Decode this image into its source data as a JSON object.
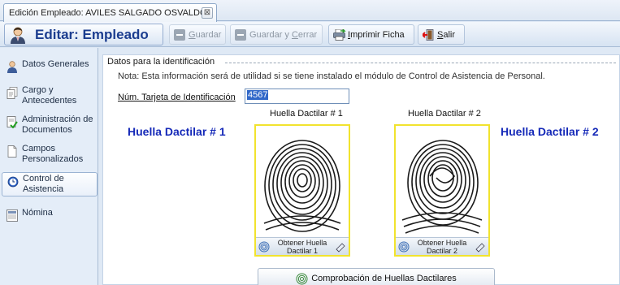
{
  "tab": {
    "label": "Edición Empleado: AVILES SALGADO OSVALDO",
    "close_glyph": "⊠"
  },
  "toolbar": {
    "title": "Editar: Empleado",
    "buttons": [
      {
        "label_ul": "G",
        "label_rest": "uardar",
        "icon": "save-icon",
        "enabled": false
      },
      {
        "label_ul": "",
        "label_rest": "Guardar y ",
        "label_ul2": "C",
        "label_rest2": "errar",
        "icon": "save-close-icon",
        "enabled": false
      },
      {
        "label_ul": "I",
        "label_rest": "mprimir Ficha",
        "icon": "print-icon",
        "enabled": true
      },
      {
        "label_ul": "S",
        "label_rest": "alir",
        "icon": "exit-icon",
        "enabled": true
      }
    ]
  },
  "sidebar": {
    "items": [
      {
        "label": "Datos Generales",
        "icon": "person-icon",
        "active": false
      },
      {
        "label": "Cargo y Antecedentes",
        "icon": "documents-icon",
        "active": false
      },
      {
        "label": "Administración de Documentos",
        "icon": "document-check-icon",
        "active": false
      },
      {
        "label": "Campos Personalizados",
        "icon": "page-icon",
        "active": false
      },
      {
        "label": "Control de Asistencia",
        "icon": "clock-icon",
        "active": true
      },
      {
        "label": "Nómina",
        "icon": "payroll-icon",
        "active": false
      }
    ]
  },
  "section": {
    "title": "Datos para la identificación",
    "note": "Nota: Esta información será de utilidad si se tiene instalado el módulo de Control de Asistencia de Personal.",
    "card_label": "Núm. Tarjeta de Identificación",
    "card_value": "4567"
  },
  "fingerprints": [
    {
      "big_label": "Huella Dactilar # 1",
      "small_label": "Huella Dactilar # 1",
      "button": "Obtener Huella Dactilar 1"
    },
    {
      "big_label": "Huella Dactilar # 2",
      "small_label": "Huella Dactilar # 2",
      "button": "Obtener Huella Dactilar 2"
    }
  ],
  "verify_button": "Comprobación de Huellas Dactilares",
  "colors": {
    "title_blue": "#1b3d8f",
    "fingerprint_label_blue": "#1529b8",
    "fingerprint_frame_yellow": "#f1e32e"
  }
}
